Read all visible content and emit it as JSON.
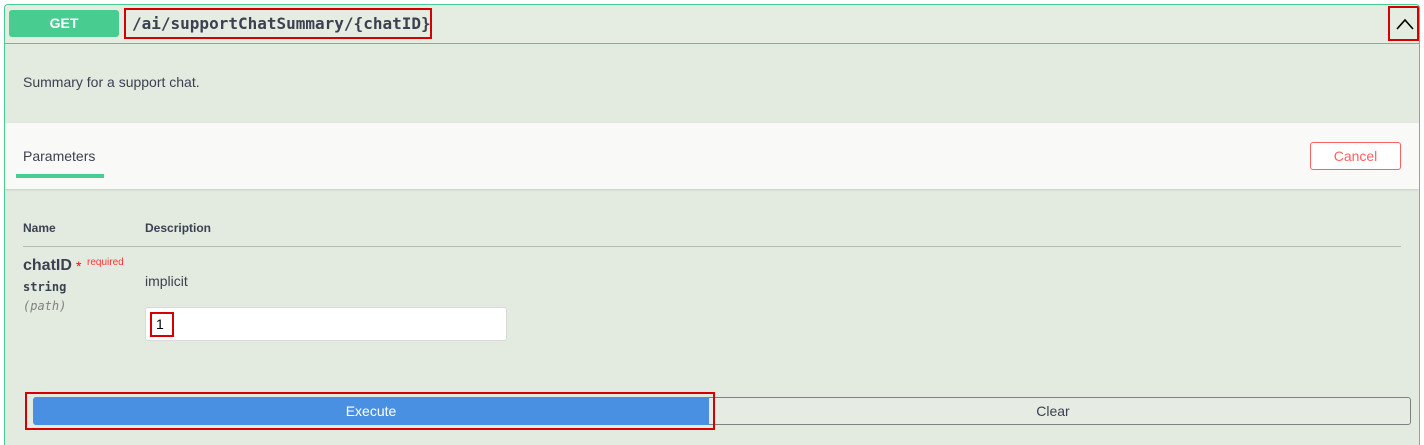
{
  "endpoint": {
    "method": "GET",
    "path": "/ai/supportChatSummary/{chatID}",
    "description": "Summary for a support chat.",
    "collapse_icon": "chevron-up-icon"
  },
  "params_section": {
    "tab_label": "Parameters",
    "cancel_label": "Cancel",
    "columns": {
      "name": "Name",
      "description": "Description"
    }
  },
  "parameter": {
    "name": "chatID",
    "required_star": "*",
    "required_label": "required",
    "type": "string",
    "in": "(path)",
    "description": "implicit",
    "value": "1"
  },
  "actions": {
    "execute_label": "Execute",
    "clear_label": "Clear"
  },
  "colors": {
    "get_green": "#49cc90",
    "execute_blue": "#4990e2",
    "cancel_red": "#ff6060",
    "highlight_red": "#d40000"
  }
}
